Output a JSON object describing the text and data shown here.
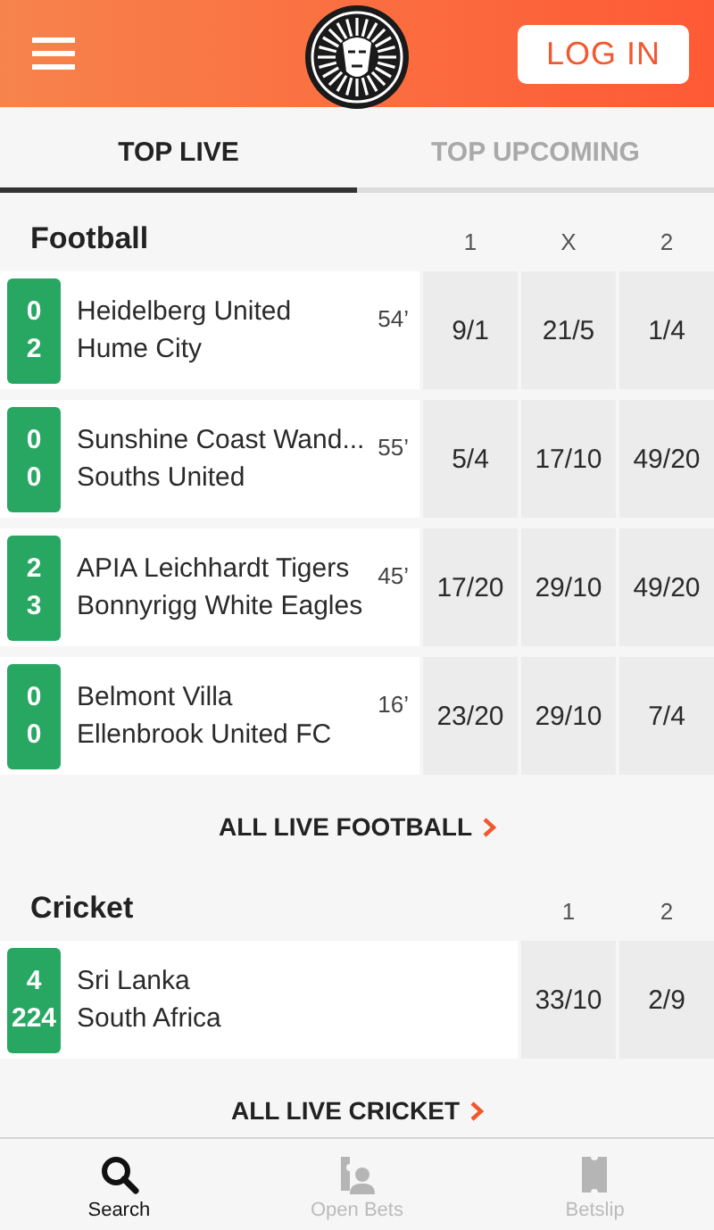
{
  "header": {
    "login_button": "LOG IN"
  },
  "tabs": [
    {
      "label": "TOP LIVE",
      "selected": true
    },
    {
      "label": "TOP UPCOMING",
      "selected": false
    }
  ],
  "sections": [
    {
      "title": "Football",
      "columns": [
        "1",
        "X",
        "2"
      ],
      "matches": [
        {
          "scores": [
            "0",
            "2"
          ],
          "teams": [
            "Heidelberg United",
            "Hume City"
          ],
          "minute": "54’",
          "odds": [
            "9/1",
            "21/5",
            "1/4"
          ]
        },
        {
          "scores": [
            "0",
            "0"
          ],
          "teams": [
            "Sunshine Coast Wand...",
            "Souths United"
          ],
          "minute": "55’",
          "odds": [
            "5/4",
            "17/10",
            "49/20"
          ]
        },
        {
          "scores": [
            "2",
            "3"
          ],
          "teams": [
            "APIA Leichhardt Tigers",
            "Bonnyrigg White Eagles"
          ],
          "minute": "45’",
          "odds": [
            "17/20",
            "29/10",
            "49/20"
          ]
        },
        {
          "scores": [
            "0",
            "0"
          ],
          "teams": [
            "Belmont Villa",
            "Ellenbrook United FC"
          ],
          "minute": "16’",
          "odds": [
            "23/20",
            "29/10",
            "7/4"
          ]
        }
      ],
      "link": "ALL LIVE FOOTBALL"
    },
    {
      "title": "Cricket",
      "columns": [
        "1",
        "2"
      ],
      "matches": [
        {
          "scores": [
            "4",
            "224"
          ],
          "teams": [
            "Sri Lanka",
            "South Africa"
          ],
          "odds": [
            "33/10",
            "2/9"
          ]
        }
      ],
      "link": "ALL LIVE CRICKET"
    }
  ],
  "bottom_nav": [
    {
      "label": "Search",
      "kind": "search",
      "selected": true
    },
    {
      "label": "Open Bets",
      "kind": "open-bets",
      "selected": false
    },
    {
      "label": "Betslip",
      "kind": "betslip",
      "selected": false
    }
  ]
}
